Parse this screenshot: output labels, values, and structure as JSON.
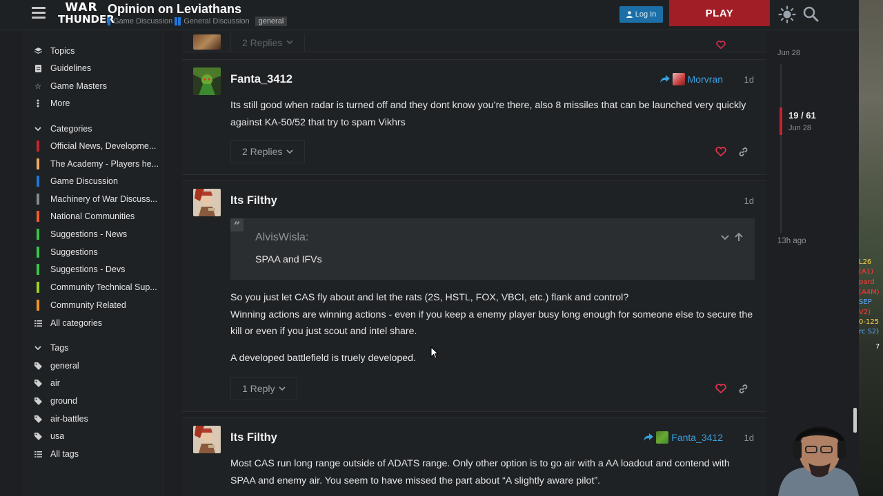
{
  "header": {
    "logo_line1": "WAR",
    "logo_line2": "THUNDER",
    "topic_title": "Opinion on Leviathans",
    "breadcrumbs": [
      {
        "label": "Game Discussion",
        "color": "#1f77d6"
      },
      {
        "label": "General Discussion",
        "color": "#1f77d6"
      }
    ],
    "tag": "general",
    "login_label": "Log In",
    "play_label": "PLAY"
  },
  "sidebar": {
    "top_items": [
      {
        "label": "Topics",
        "icon": "layers-icon"
      },
      {
        "label": "Guidelines",
        "icon": "guidelines-icon"
      },
      {
        "label": "Game Masters",
        "icon": "star-icon"
      },
      {
        "label": "More",
        "icon": "more-vertical-icon"
      }
    ],
    "categories_header": "Categories",
    "categories": [
      {
        "label": "Official News, Developme...",
        "color": "#c4262e"
      },
      {
        "label": "The Academy - Players he...",
        "color": "#f0a866"
      },
      {
        "label": "Game Discussion",
        "color": "#1f77d6"
      },
      {
        "label": "Machinery of War Discuss...",
        "color": "#8a8a8a"
      },
      {
        "label": "National Communities",
        "color": "#f25a2a"
      },
      {
        "label": "Suggestions - News",
        "color": "#3ac448"
      },
      {
        "label": "Suggestions",
        "color": "#3ac448"
      },
      {
        "label": "Suggestions - Devs",
        "color": "#3ac448"
      },
      {
        "label": "Community Technical Sup...",
        "color": "#9bd41c"
      },
      {
        "label": "Community Related",
        "color": "#f2922a"
      }
    ],
    "all_categories_label": "All categories",
    "tags_header": "Tags",
    "tags": [
      "general",
      "air",
      "ground",
      "air-battles",
      "usa"
    ],
    "all_tags_label": "All tags"
  },
  "posts": [
    {
      "partial_replies_label": "2 Replies"
    },
    {
      "username": "Fanta_3412",
      "reply_to": "Morvran",
      "date": "1d",
      "text": "Its still good when radar is turned off and they dont know you’re there, also 8 missiles that can be launched very quickly against KA-50/52 that try to spam Vikhrs",
      "replies_label": "2 Replies"
    },
    {
      "username": "Its Filthy",
      "date": "1d",
      "quote_author": "AlvisWisla:",
      "quote_text": "SPAA and IFVs",
      "paragraph1_line1": "So you just let CAS fly about and let the rats (2S, HSTL, FOX, VBCI, etc.) flank and control?",
      "paragraph1_line2": "Winning actions are winning actions - even if you keep a enemy player busy long enough for someone else to secure the kill or even if you just scout and intel share.",
      "paragraph2": "A developed battlefield is truely developed.",
      "replies_label": "1 Reply"
    },
    {
      "username": "Its Filthy",
      "reply_to": "Fanta_3412",
      "date": "1d",
      "text": "Most CAS run long range outside of ADATS range. Only other option is to go air with a AA loadout and contend with SPAA and enemy air. You seem to have missed the part about “A slightly aware pilot”."
    }
  ],
  "timeline": {
    "top_date": "Jun 28",
    "position": "19 / 61",
    "position_date": "Jun 28",
    "bottom_label": "13h ago"
  },
  "game_overlay": {
    "lines": [
      "L26",
      "(A1)",
      "pard",
      "(A4M)",
      "SEP",
      "V2)",
      "0-125",
      "rc S2)",
      "7"
    ]
  },
  "colors": {
    "accent_blue": "#3aa0dd",
    "play_red": "#a21e27",
    "heart_red": "#e3314b",
    "timeline_red": "#c8242e"
  }
}
